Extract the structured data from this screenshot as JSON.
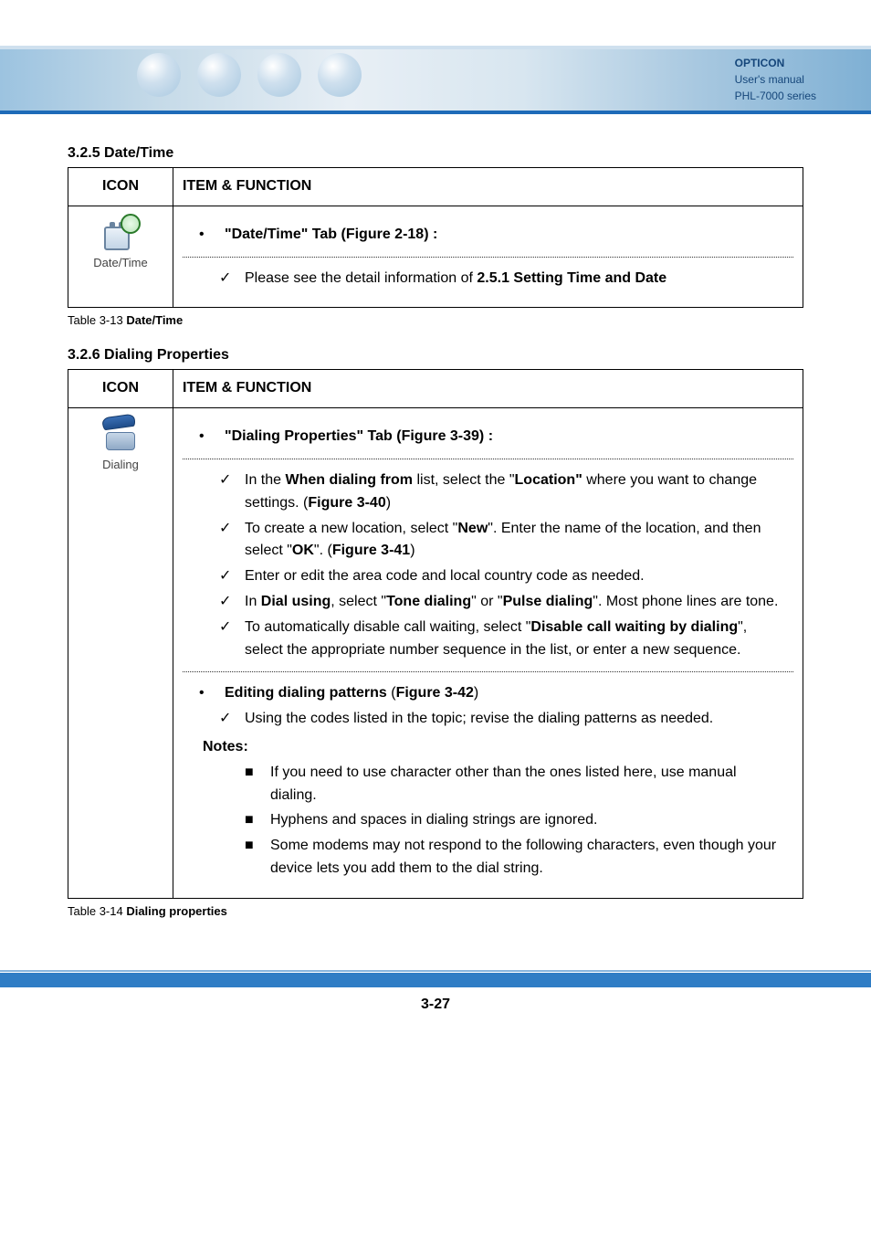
{
  "header": {
    "brand": "OPTICON",
    "line2": "User's manual",
    "line3": "PHL-7000 series"
  },
  "section1": {
    "title": "3.2.5 Date/Time",
    "icon_header": "ICON",
    "func_header": "ITEM & FUNCTION",
    "icon_label": "Date/Time",
    "row1": "\"Date/Time\" Tab (Figure 2-18) :",
    "row2_a": "Please see the detail information of ",
    "row2_b": "2.5.1 Setting Time and Date",
    "caption_a": "Table 3-13 ",
    "caption_b": "Date/Time"
  },
  "section2": {
    "title": "3.2.6 Dialing Properties",
    "icon_header": "ICON",
    "func_header": "ITEM & FUNCTION",
    "icon_label": "Dialing",
    "blockA": {
      "heading": "\"Dialing Properties\" Tab (Figure 3-39) :",
      "i1_a": "In the ",
      "i1_b": "When dialing from",
      "i1_c": " list, select the \"",
      "i1_d": "Location\"",
      "i1_e": " where you want to change settings. (",
      "i1_f": "Figure 3-40",
      "i1_g": ")",
      "i2_a": "To create a new location, select \"",
      "i2_b": "New",
      "i2_c": "\". Enter the name of the location, and then select \"",
      "i2_d": "OK",
      "i2_e": "\". (",
      "i2_f": "Figure 3-41",
      "i2_g": ")",
      "i3": "Enter or edit the area code and local country code as needed.",
      "i4_a": "In ",
      "i4_b": "Dial using",
      "i4_c": ", select \"",
      "i4_d": "Tone dialing",
      "i4_e": "\" or \"",
      "i4_f": "Pulse dialing",
      "i4_g": "\". Most phone lines are tone.",
      "i5_a": "To automatically disable call waiting, select \"",
      "i5_b": "Disable call waiting by dialing",
      "i5_c": "\", select the appropriate number sequence in the list, or enter a new sequence."
    },
    "blockB": {
      "heading_a": "Editing dialing patterns",
      "heading_b": " (",
      "heading_c": "Figure 3-42",
      "heading_d": ")",
      "c1": "Using the codes listed in the topic; revise the dialing patterns as needed.",
      "notes_label": "Notes:",
      "n1": "If you need to use character other than the ones listed here, use manual dialing.",
      "n2": "Hyphens and spaces in dialing strings are ignored.",
      "n3": "Some modems may not respond to the following characters, even though your device lets you add them to the dial string."
    },
    "caption_a": "Table 3-14 ",
    "caption_b": "Dialing properties"
  },
  "page_number": "3-27"
}
